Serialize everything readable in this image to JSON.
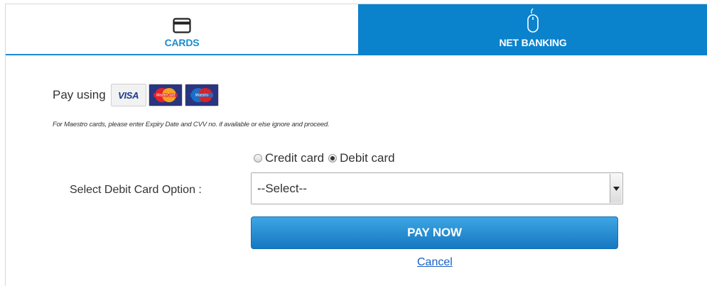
{
  "tabs": {
    "cards": {
      "label": "CARDS",
      "icon": "credit-card-icon"
    },
    "net_banking": {
      "label": "NET BANKING",
      "icon": "mouse-icon"
    }
  },
  "payment": {
    "pay_using_label": "Pay using",
    "card_logos": [
      {
        "name": "VISA",
        "icon": "visa-logo"
      },
      {
        "name": "MasterCard",
        "icon": "mastercard-logo"
      },
      {
        "name": "Maestro",
        "icon": "maestro-logo"
      }
    ],
    "maestro_note": "For Maestro cards, please enter Expiry Date and CVV no. if available or else ignore and proceed.",
    "card_type": {
      "options": [
        "Credit card",
        "Debit card"
      ],
      "selected": "Debit card"
    },
    "select_label": "Select Debit Card Option :",
    "select_value": "--Select--",
    "pay_button": "PAY NOW",
    "cancel_link": "Cancel"
  },
  "colors": {
    "accent": "#0b82cc",
    "button_top": "#3da6e3",
    "button_bottom": "#1578c0",
    "link": "#1a5fc4"
  }
}
